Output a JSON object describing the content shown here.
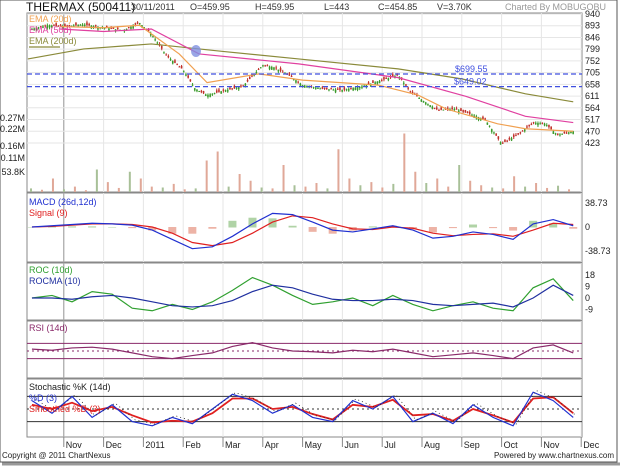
{
  "header": {
    "title": "THERMAX (500411)",
    "date": "30/11/2011",
    "open": "O=459.95",
    "high": "H=459.95",
    "low": "L=443",
    "close": "C=454.85",
    "volume": "V=3.70K",
    "charted_by": "Charted By MOBUGOBU"
  },
  "footer": {
    "copyright": "Copyright @ 2011 ChartNexus",
    "powered": "Powered by www.chartnexus.com"
  },
  "colors": {
    "up": "#3a9a2a",
    "down": "#c0302a",
    "ema20": "#f0a050",
    "ema50": "#e040a0",
    "ema200": "#8a8a3a",
    "macd": "#2030d0",
    "signal": "#e02020",
    "roc": "#30a030",
    "rocma": "#2030a0",
    "rsi": "#8a2a6a",
    "stoch_k": "#2030d0",
    "stoch_d": "#e02020",
    "level": "#4050e0"
  },
  "chart_data": [
    {
      "type": "line",
      "title": "Price",
      "x_ticks": [
        "Nov",
        "Dec",
        "2011",
        "Feb",
        "Mar",
        "Apr",
        "May",
        "Jun",
        "Jul",
        "Aug",
        "Sep",
        "Oct",
        "Nov",
        "Dec"
      ],
      "y_ticks": [
        "940",
        "893",
        "846",
        "799",
        "752",
        "705",
        "658",
        "611",
        "564",
        "517",
        "470",
        "423"
      ],
      "ylim": [
        423,
        940
      ],
      "xlim_months": [
        0.1,
        14
      ],
      "legend": [
        "EMA (20d)",
        "EMA (50d)",
        "EMA (200d)"
      ],
      "price": [
        [
          0.2,
          880
        ],
        [
          0.6,
          895
        ],
        [
          1.0,
          890
        ],
        [
          1.5,
          898
        ],
        [
          2.0,
          885
        ],
        [
          2.5,
          875
        ],
        [
          2.9,
          905
        ],
        [
          3.2,
          860
        ],
        [
          3.6,
          770
        ],
        [
          4.0,
          716
        ],
        [
          4.3,
          640
        ],
        [
          4.6,
          615
        ],
        [
          5.0,
          632
        ],
        [
          5.5,
          650
        ],
        [
          6.0,
          735
        ],
        [
          6.3,
          725
        ],
        [
          6.7,
          690
        ],
        [
          7.0,
          655
        ],
        [
          7.5,
          640
        ],
        [
          8.0,
          635
        ],
        [
          8.5,
          650
        ],
        [
          9.0,
          675
        ],
        [
          9.4,
          695
        ],
        [
          9.7,
          630
        ],
        [
          10.0,
          595
        ],
        [
          10.4,
          555
        ],
        [
          10.8,
          560
        ],
        [
          11.2,
          540
        ],
        [
          11.6,
          515
        ],
        [
          12.0,
          420
        ],
        [
          12.4,
          455
        ],
        [
          12.8,
          505
        ],
        [
          13.1,
          500
        ],
        [
          13.4,
          455
        ],
        [
          13.8,
          470
        ]
      ],
      "ema20": [
        [
          0.9,
          890
        ],
        [
          2.0,
          885
        ],
        [
          2.9,
          895
        ],
        [
          3.9,
          780
        ],
        [
          4.6,
          665
        ],
        [
          5.9,
          700
        ],
        [
          7.0,
          675
        ],
        [
          8.9,
          655
        ],
        [
          9.9,
          615
        ],
        [
          10.6,
          560
        ],
        [
          11.9,
          500
        ],
        [
          12.6,
          480
        ],
        [
          13.8,
          470
        ]
      ],
      "ema50": [
        [
          0.9,
          880
        ],
        [
          2.0,
          870
        ],
        [
          3.2,
          880
        ],
        [
          4.4,
          780
        ],
        [
          6.9,
          740
        ],
        [
          9.4,
          685
        ],
        [
          11.1,
          610
        ],
        [
          12.6,
          530
        ],
        [
          13.8,
          505
        ]
      ],
      "ema200": [
        [
          0.1,
          760
        ],
        [
          1.5,
          800
        ],
        [
          3.2,
          820
        ],
        [
          5.0,
          790
        ],
        [
          6.9,
          760
        ],
        [
          9.4,
          720
        ],
        [
          11.0,
          680
        ],
        [
          12.6,
          620
        ],
        [
          13.8,
          588
        ]
      ],
      "levels": [
        {
          "value": 699.55,
          "label": "$699.55"
        },
        {
          "value": 649.02,
          "label": "$649.02"
        }
      ],
      "volume_ticks": [
        "0.27M",
        "0.22M",
        "0.16M",
        "0.11M",
        "53.8K"
      ],
      "volume_k": [
        8,
        5,
        30,
        6,
        12,
        4,
        50,
        22,
        9,
        45,
        30,
        12,
        10,
        18,
        6,
        8,
        70,
        90,
        12,
        40,
        25,
        10,
        8,
        60,
        15,
        12,
        20,
        8,
        95,
        30,
        15,
        22,
        10,
        18,
        130,
        45,
        20,
        30,
        12,
        60,
        25,
        15,
        10,
        8,
        35,
        12,
        20,
        9,
        14,
        6
      ]
    },
    {
      "type": "line",
      "title": "MACD (26d,12d)",
      "legend": [
        "MACD (26d,12d)",
        "Signal (9)"
      ],
      "y_ticks": [
        "38.73",
        "0",
        "-38.73"
      ],
      "ylim": [
        -38.73,
        38.73
      ],
      "macd": [
        0,
        2,
        4,
        6,
        5,
        3,
        -5,
        -20,
        -35,
        -32,
        -15,
        5,
        22,
        20,
        8,
        -5,
        -8,
        -3,
        2,
        -5,
        -18,
        -15,
        -8,
        -12,
        -20,
        5,
        12,
        2
      ],
      "signal": [
        0,
        1,
        3,
        5,
        5,
        4,
        0,
        -10,
        -25,
        -30,
        -25,
        -10,
        8,
        18,
        15,
        5,
        -3,
        -4,
        0,
        -2,
        -10,
        -14,
        -12,
        -11,
        -15,
        -5,
        6,
        4
      ]
    },
    {
      "type": "line",
      "title": "ROC (10d)",
      "legend": [
        "ROC (10d)",
        "ROCMA (10)"
      ],
      "y_ticks": [
        "18",
        "9",
        "0",
        "-9"
      ],
      "ylim": [
        -12,
        22
      ],
      "roc": [
        0,
        2,
        -3,
        5,
        3,
        -8,
        -10,
        -5,
        -9,
        -3,
        6,
        16,
        10,
        2,
        -5,
        -3,
        0,
        -6,
        2,
        -5,
        -10,
        -6,
        -3,
        -8,
        -10,
        8,
        15,
        -2
      ],
      "rocma": [
        0,
        0,
        -1,
        1,
        2,
        0,
        -3,
        -6,
        -7,
        -6,
        -2,
        5,
        10,
        8,
        3,
        -1,
        -2,
        -2,
        -1,
        -2,
        -5,
        -6,
        -5,
        -4,
        -7,
        0,
        10,
        2
      ]
    },
    {
      "type": "line",
      "title": "RSI (14d)",
      "ylim": [
        0,
        100
      ],
      "levels": [
        70,
        50,
        30
      ],
      "rsi": [
        55,
        52,
        58,
        60,
        55,
        45,
        35,
        30,
        38,
        45,
        62,
        72,
        58,
        50,
        48,
        45,
        52,
        48,
        55,
        45,
        35,
        40,
        45,
        38,
        30,
        58,
        66,
        45
      ]
    },
    {
      "type": "line",
      "title": "Stochastic %K (14d)",
      "legend": [
        "Stochastic %K (14d)",
        "%D (3)",
        "Smoothed %D (3)"
      ],
      "ylim": [
        0,
        100
      ],
      "levels": [
        80,
        50,
        20
      ],
      "k": [
        70,
        40,
        80,
        30,
        60,
        20,
        10,
        30,
        15,
        50,
        85,
        70,
        40,
        60,
        30,
        20,
        70,
        50,
        80,
        20,
        40,
        15,
        60,
        30,
        10,
        90,
        70,
        30
      ],
      "d": [
        60,
        50,
        65,
        45,
        55,
        35,
        18,
        22,
        20,
        40,
        75,
        75,
        50,
        55,
        38,
        25,
        60,
        55,
        72,
        35,
        38,
        22,
        50,
        35,
        18,
        75,
        78,
        40
      ]
    }
  ]
}
